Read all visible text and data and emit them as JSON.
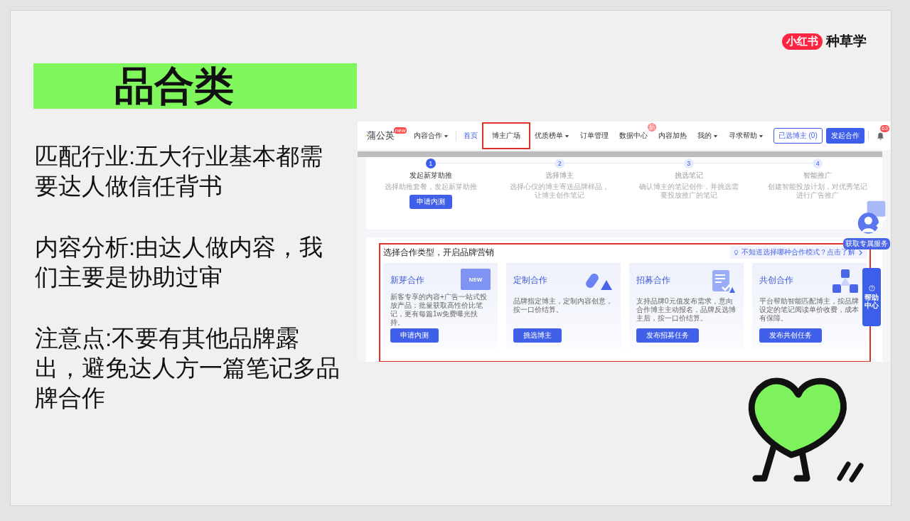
{
  "brand_logo": {
    "badge": "小红书",
    "text": "种草学"
  },
  "title": "品合类",
  "notes": [
    "匹配行业:五大行业基本都需要达人做信任背书",
    "内容分析:由达人做内容，我们主要是协助过审",
    "注意点:不要有其他品牌露出，避免达人方一篇笔记多品牌合作"
  ],
  "app": {
    "logo": "蒲公英",
    "logo_badge": "new",
    "nav": [
      {
        "label": "内容合作",
        "dropdown": true,
        "selected": false,
        "highlighted": false
      },
      {
        "label": "首页",
        "dropdown": false,
        "selected": true,
        "highlighted": false
      },
      {
        "label": "博主广场",
        "dropdown": false,
        "selected": false,
        "highlighted": true
      },
      {
        "label": "优质榜单",
        "dropdown": true,
        "selected": false,
        "highlighted": false
      },
      {
        "label": "订单管理",
        "dropdown": false,
        "selected": false,
        "highlighted": false
      },
      {
        "label": "数据中心",
        "dropdown": false,
        "selected": false,
        "highlighted": false,
        "badge": "新"
      },
      {
        "label": "内容加热",
        "dropdown": false,
        "selected": false,
        "highlighted": false
      },
      {
        "label": "我的",
        "dropdown": true,
        "selected": false,
        "highlighted": false
      },
      {
        "label": "寻求帮助",
        "dropdown": true,
        "selected": false,
        "highlighted": false
      }
    ],
    "selected_button": "已选博主 (0)",
    "primary_button": "发起合作",
    "bell_badge": "63",
    "steps": [
      {
        "number": "1",
        "title": "发起新芽助推",
        "desc": "选择助推套餐，发起新芽助推",
        "button": "申请内测",
        "active": true
      },
      {
        "number": "2",
        "title": "选择博主",
        "desc": "选择心仪的博主寄送品牌样品，让博主创作笔记",
        "active": false
      },
      {
        "number": "3",
        "title": "挑选笔记",
        "desc": "确认博主的笔记创作，并挑选需要投放推广的笔记",
        "active": false
      },
      {
        "number": "4",
        "title": "智能推广",
        "desc": "创建智能投放计划，对优秀笔记进行广告推广",
        "active": false
      }
    ],
    "section": {
      "title": "选择合作类型，开启品牌营销",
      "hint": "不知道选择哪种合作模式？点击了解",
      "highlighted": true,
      "cards": [
        {
          "title": "新芽合作",
          "kind": "new",
          "art_text": "NEW",
          "desc": "新客专享的内容+广告一站式投放产品：批量获取高性价比笔记，更有每篇1w免费曝光扶持。",
          "button": "申请内测"
        },
        {
          "title": "定制合作",
          "kind": "shapes",
          "desc": "品牌指定博主，定制内容创意，按一口价结算。",
          "button": "挑选博主"
        },
        {
          "title": "招募合作",
          "kind": "clipboard",
          "desc": "支持品牌0元值发布需求，意向合作博主主动报名，品牌反选博主后，按一口价结算。",
          "button": "发布招募任务"
        },
        {
          "title": "共创合作",
          "kind": "triangles",
          "desc": "平台帮助智能匹配博主，按品牌设定的笔记阅读单价收费，成本有保障。",
          "button": "发布共创任务"
        }
      ]
    },
    "service_label": "获取专属服务",
    "help_button": "帮助中心"
  }
}
